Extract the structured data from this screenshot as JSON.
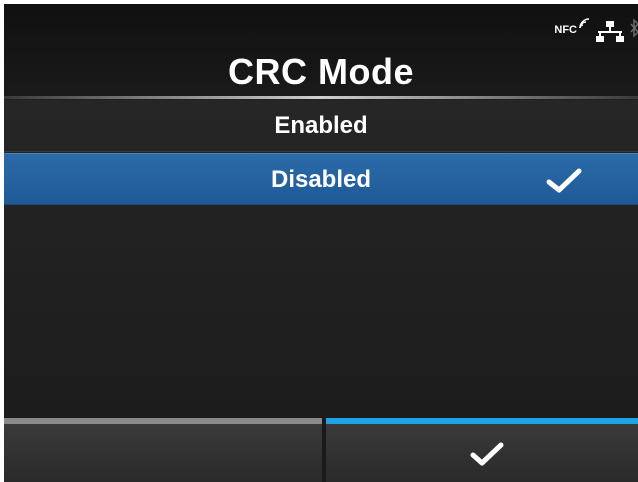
{
  "header": {
    "title": "CRC Mode",
    "status_icons": [
      "nfc-icon",
      "network-icon",
      "bluetooth-icon"
    ],
    "nfc_label": "NFC"
  },
  "options": {
    "items": [
      {
        "label": "Enabled",
        "selected": false
      },
      {
        "label": "Disabled",
        "selected": true
      }
    ],
    "selected_indicator_icon": "checkmark-icon"
  },
  "softkeys": {
    "left_icon": "",
    "right_icon": "checkmark-icon"
  },
  "colors": {
    "background": "#1f1f1f",
    "selected_row": "#2563a0",
    "accent_blue": "#1ea4e8",
    "softkey_left_bar": "#8a8a8a",
    "text": "#ffffff"
  }
}
